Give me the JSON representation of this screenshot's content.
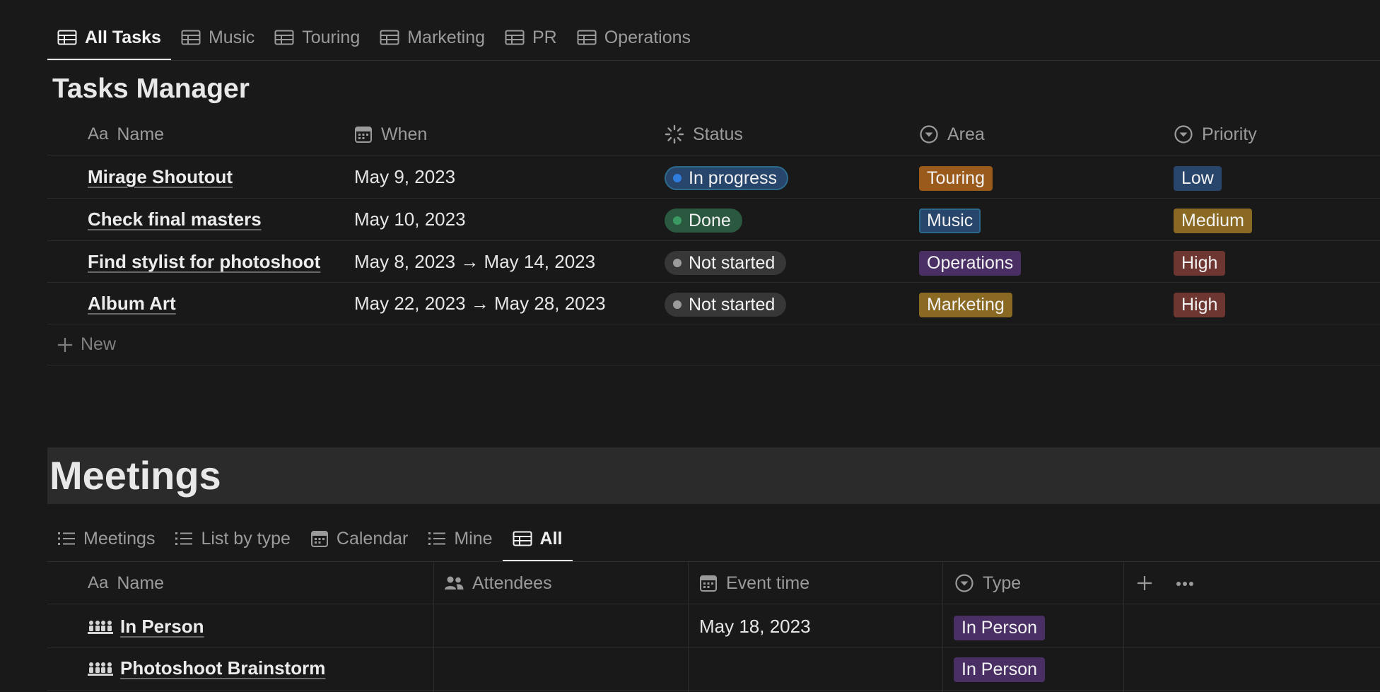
{
  "top_tabs": [
    {
      "label": "All Tasks",
      "icon": "table-icon",
      "active": true
    },
    {
      "label": "Music",
      "icon": "table-icon"
    },
    {
      "label": "Touring",
      "icon": "table-icon"
    },
    {
      "label": "Marketing",
      "icon": "table-icon"
    },
    {
      "label": "PR",
      "icon": "table-icon"
    },
    {
      "label": "Operations",
      "icon": "table-icon"
    }
  ],
  "tasks": {
    "title": "Tasks Manager",
    "columns": {
      "name": {
        "label": "Name",
        "icon_text": "Aa"
      },
      "when": {
        "label": "When",
        "icon": "calendar-icon"
      },
      "status": {
        "label": "Status",
        "icon": "status-spinner-icon"
      },
      "area": {
        "label": "Area",
        "icon": "select-icon"
      },
      "priority": {
        "label": "Priority",
        "icon": "select-icon"
      }
    },
    "rows": [
      {
        "name": "Mirage Shoutout",
        "when": "May 9, 2023",
        "status": "In progress",
        "area": "Touring",
        "priority": "Low"
      },
      {
        "name": "Check final masters",
        "when": "May 10, 2023",
        "status": "Done",
        "area": "Music",
        "priority": "Medium"
      },
      {
        "name": "Find stylist for photoshoot",
        "when": "May 8, 2023 → May 14, 2023",
        "status": "Not started",
        "area": "Operations",
        "priority": "High"
      },
      {
        "name": "Album Art",
        "when": "May 22, 2023 → May 28, 2023",
        "status": "Not started",
        "area": "Marketing",
        "priority": "High"
      }
    ],
    "new_label": "New"
  },
  "meetings": {
    "title": "Meetings",
    "tabs": [
      {
        "label": "Meetings",
        "icon": "list-icon"
      },
      {
        "label": "List by type",
        "icon": "list-icon"
      },
      {
        "label": "Calendar",
        "icon": "calendar-icon"
      },
      {
        "label": "Mine",
        "icon": "list-icon"
      },
      {
        "label": "All",
        "icon": "table-icon",
        "active": true
      }
    ],
    "columns": {
      "name": {
        "label": "Name",
        "icon_text": "Aa"
      },
      "attendees": {
        "label": "Attendees",
        "icon": "people-icon"
      },
      "event_time": {
        "label": "Event time",
        "icon": "calendar-icon"
      },
      "type": {
        "label": "Type",
        "icon": "select-icon"
      }
    },
    "rows": [
      {
        "name": "In Person",
        "icon": "group-meeting-icon",
        "attendees": "",
        "event_time": "May 18, 2023",
        "type": "In Person"
      },
      {
        "name": "Photoshoot Brainstorm",
        "icon": "group-meeting-icon",
        "attendees": "",
        "event_time": "",
        "type": "In Person"
      }
    ]
  },
  "colors": {
    "background": "#191919",
    "status_in_progress_bg": "#28456c",
    "status_in_progress_dot": "#2f7ddc",
    "status_done_bg": "#2b593f",
    "status_done_dot": "#3b9a63",
    "status_not_started_bg": "#373737",
    "status_not_started_dot": "#9b9b9b",
    "tag_orange": "#9a5a1c",
    "tag_blue": "#28456c",
    "tag_purple": "#492f64",
    "tag_yellow": "#8a6a23",
    "tag_red": "#6e3630"
  }
}
